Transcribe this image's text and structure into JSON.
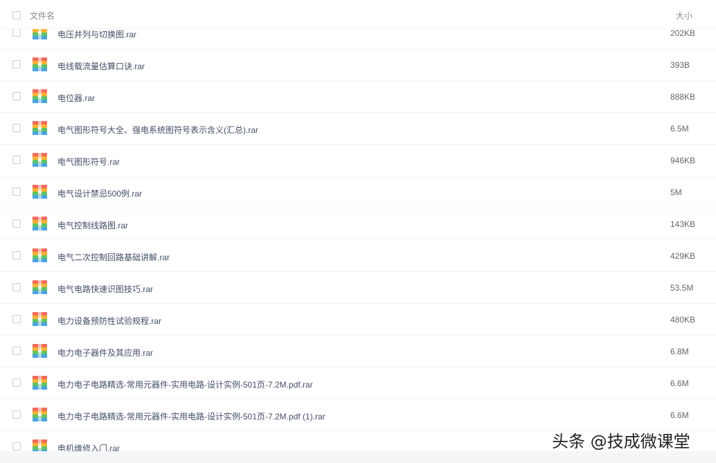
{
  "header": {
    "name_label": "文件名",
    "size_label": "大小"
  },
  "files": [
    {
      "name": "电压并列与切换图.rar",
      "size": "202KB"
    },
    {
      "name": "电线载流量估算口诀.rar",
      "size": "393B"
    },
    {
      "name": "电位器.rar",
      "size": "888KB"
    },
    {
      "name": "电气图形符号大全、强电系统图符号表示含义(汇总).rar",
      "size": "6.5M"
    },
    {
      "name": "电气图形符号.rar",
      "size": "946KB"
    },
    {
      "name": "电气设计禁忌500例.rar",
      "size": "5M"
    },
    {
      "name": "电气控制线路图.rar",
      "size": "143KB"
    },
    {
      "name": "电气二次控制回路基础讲解.rar",
      "size": "429KB"
    },
    {
      "name": "电气电路快速识图技巧.rar",
      "size": "53.5M"
    },
    {
      "name": "电力设备预防性试验规程.rar",
      "size": "480KB"
    },
    {
      "name": "电力电子器件及其应用.rar",
      "size": "6.8M"
    },
    {
      "name": "电力电子电路精选-常用元器件-实用电路-设计实例-501页-7.2M.pdf.rar",
      "size": "6.6M"
    },
    {
      "name": "电力电子电路精选-常用元器件-实用电路-设计实例-501页-7.2M.pdf (1).rar",
      "size": "6.6M"
    },
    {
      "name": "电机维修入门.rar",
      "size": ""
    }
  ],
  "icon": {
    "name": "rar-archive-icon",
    "colors": [
      "#f26b5b",
      "#f9b233",
      "#5dc26a",
      "#4aa3df"
    ]
  },
  "watermark": "头条 @技成微课堂"
}
